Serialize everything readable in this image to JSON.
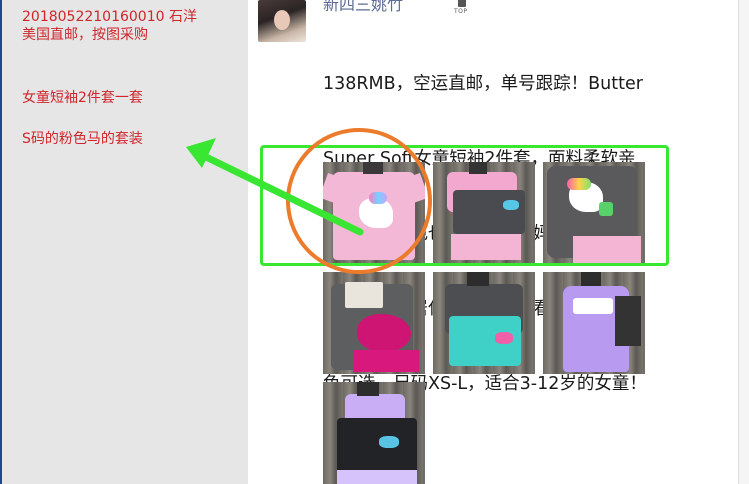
{
  "annotations": {
    "order_number": "2018052210160010 石洋",
    "shipping": "美国直邮，按图采购",
    "item": "女童短袖2件套一套",
    "spec": "S码的粉色马的套装"
  },
  "post": {
    "username": "新四三姚竹",
    "pin_label": "TOP",
    "text_lines": [
      "138RMB，空运直邮，单号跟踪！Butter",
      "Super Soft女童短袖2件套，面料柔软亲",
      "肤，衣服配色也好看哇，宝妈们不用为搭",
      "配头疼，家居休闲外穿都好看，有3款配",
      "色可选，尺码XS-L，适合3-12岁的女童！"
    ]
  },
  "photos": [
    {
      "label": "pink-unicorn-tee"
    },
    {
      "label": "pink-tee-grey-shorts"
    },
    {
      "label": "grey-unicorn-tee"
    },
    {
      "label": "grey-tee-magenta-lips"
    },
    {
      "label": "teal-shorts-set"
    },
    {
      "label": "purple-tank-set"
    },
    {
      "label": "lavender-dress-black-shorts"
    }
  ],
  "colors": {
    "annotation_text": "#d0262b",
    "highlight_green": "#39e631",
    "circle_orange": "#ec7b2b",
    "username_blue": "#5b6b93"
  }
}
